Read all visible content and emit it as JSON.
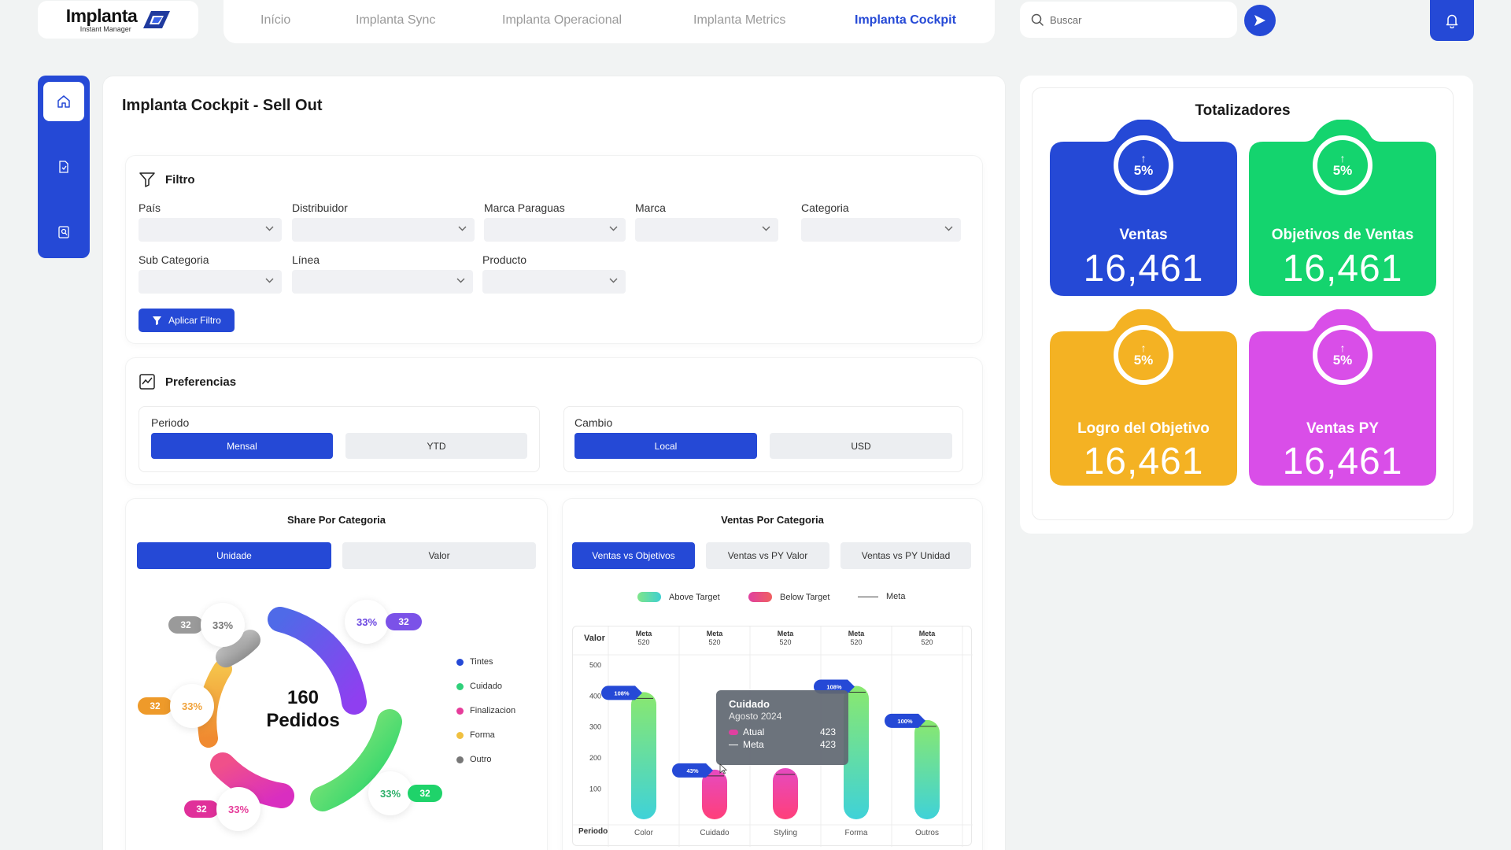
{
  "logo": {
    "title": "Implanta",
    "subtitle": "Instant Manager"
  },
  "nav": {
    "items": [
      "Início",
      "Implanta Sync",
      "Implanta Operacional",
      "Implanta Metrics",
      "Implanta Cockpit"
    ],
    "active": "Implanta Cockpit"
  },
  "search": {
    "placeholder": "Buscar"
  },
  "page": {
    "title": "Implanta Cockpit  - Sell Out"
  },
  "filter": {
    "title": "Filtro",
    "fields": [
      "País",
      "Distribuidor",
      "Marca Paraguas",
      "Marca",
      "Categoria",
      "Sub Categoria",
      "Línea",
      "Producto"
    ],
    "apply_label": "Aplicar Filtro"
  },
  "preferences": {
    "title": "Preferencias",
    "periodo": {
      "label": "Periodo",
      "options": [
        "Mensal",
        "YTD"
      ],
      "selected": "Mensal"
    },
    "cambio": {
      "label": "Cambio",
      "options": [
        "Local",
        "USD"
      ],
      "selected": "Local"
    }
  },
  "share_chart": {
    "title": "Share Por Categoria",
    "tabs": [
      "Unidade",
      "Valor"
    ],
    "selected_tab": "Unidade",
    "center_value": "160",
    "center_label": "Pedidos",
    "segments": [
      {
        "name": "Outro",
        "value": 32,
        "pct": "33%",
        "color": "#8a8a8a"
      },
      {
        "name": "Tintes",
        "value": 32,
        "pct": "33%",
        "color": "#6a45e0"
      },
      {
        "name": "Forma",
        "value": 32,
        "pct": "33%",
        "color": "#f0a23a"
      },
      {
        "name": "Finalizacion",
        "value": 32,
        "pct": "33%",
        "color": "#e63c9a"
      },
      {
        "name": "Cuidado",
        "value": 32,
        "pct": "33%",
        "color": "#2fd07a"
      }
    ],
    "legend": [
      {
        "name": "Tintes",
        "color": "#2549d6"
      },
      {
        "name": "Cuidado",
        "color": "#2fd07a"
      },
      {
        "name": "Finalizacion",
        "color": "#e63c9a"
      },
      {
        "name": "Forma",
        "color": "#f0c040"
      },
      {
        "name": "Outro",
        "color": "#777777"
      }
    ]
  },
  "chart_data": {
    "type": "bar",
    "title": "Ventas Por Categoria",
    "tabs": [
      "Ventas vs Objetivos",
      "Ventas vs PY Valor",
      "Ventas vs PY Unidad"
    ],
    "selected_tab": "Ventas vs Objetivos",
    "legend": [
      "Above Target",
      "Below Target",
      "Meta"
    ],
    "ylabel": "Valor",
    "xlabel": "Periodo",
    "yticks": [
      100,
      200,
      300,
      400,
      500
    ],
    "ylim": [
      0,
      520
    ],
    "meta_header": "Meta",
    "categories": [
      "Color",
      "Cuidado",
      "Styling",
      "Forma",
      "Outros"
    ],
    "meta": [
      520,
      520,
      520,
      520,
      520
    ],
    "values": [
      410,
      160,
      165,
      430,
      320
    ],
    "status": [
      "above",
      "below",
      "below",
      "above",
      "above"
    ],
    "badges": [
      "108%",
      "43%",
      "",
      "108%",
      "100%"
    ],
    "tooltip": {
      "category": "Cuidado",
      "period": "Agosto 2024",
      "atual_label": "Atual",
      "atual": "423",
      "meta_label": "Meta",
      "meta": "423"
    }
  },
  "totalizadores": {
    "title": "Totalizadores",
    "cards": [
      {
        "label": "Ventas",
        "value": "16,461",
        "pct": "5%",
        "color": "#2549d6"
      },
      {
        "label": "Objetivos de Ventas",
        "value": "16,461",
        "pct": "5%",
        "color": "#14d46e"
      },
      {
        "label": "Logro del Objetivo",
        "value": "16,461",
        "pct": "5%",
        "color": "#f4b223"
      },
      {
        "label": "Ventas PY",
        "value": "16,461",
        "pct": "5%",
        "color": "#d94ee8"
      }
    ]
  }
}
